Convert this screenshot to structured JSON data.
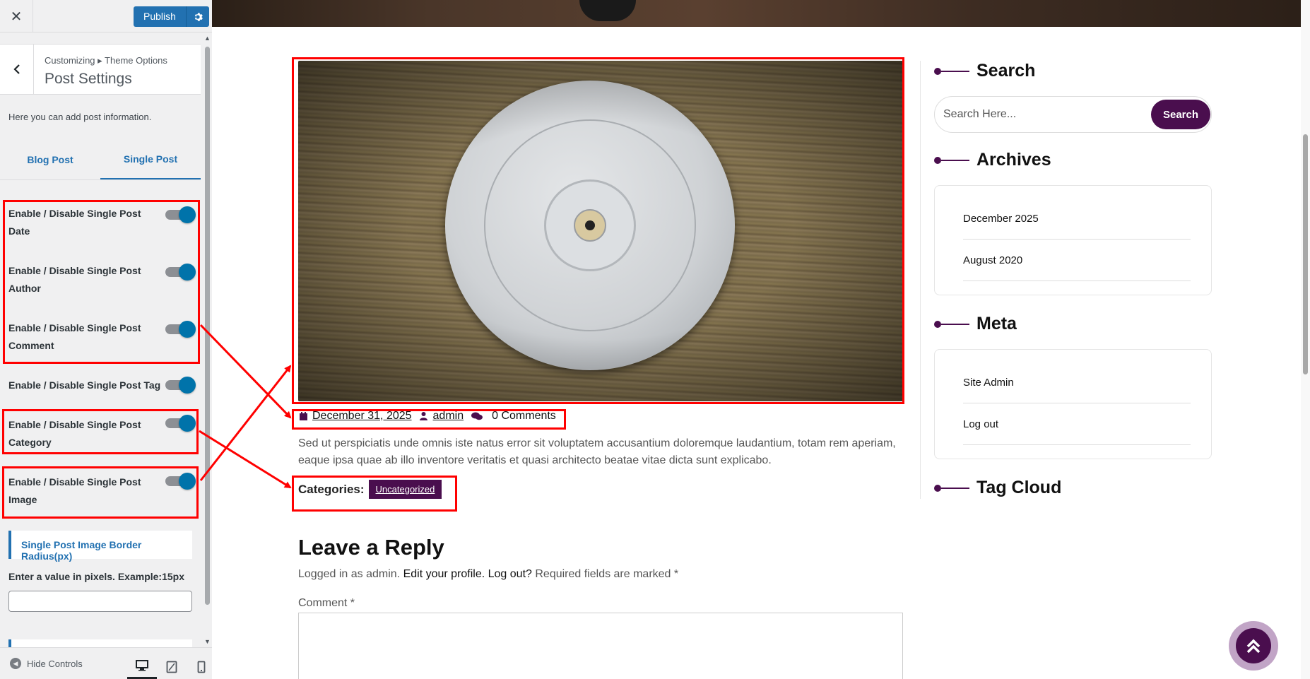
{
  "customizer": {
    "close_icon": "close-icon",
    "publish_label": "Publish",
    "breadcrumb": "Customizing ▸ Theme Options",
    "section_title": "Post Settings",
    "description": "Here you can add post information.",
    "tabs": [
      {
        "label": "Blog Post",
        "active": false
      },
      {
        "label": "Single Post",
        "active": true
      }
    ],
    "toggles": [
      {
        "label": "Enable / Disable Single Post Date",
        "on": true
      },
      {
        "label": "Enable / Disable Single Post Author",
        "on": true
      },
      {
        "label": "Enable / Disable Single Post Comment",
        "on": true
      },
      {
        "label": "Enable / Disable Single Post Tag",
        "on": true
      },
      {
        "label": "Enable / Disable Single Post Category",
        "on": true
      },
      {
        "label": "Enable / Disable Single Post Image",
        "on": true
      }
    ],
    "radius_heading": "Single Post Image Border Radius(px)",
    "pixels_label": "Enter a value in pixels. Example:15px",
    "pixels_value": "",
    "hide_controls": "Hide Controls"
  },
  "post": {
    "date": "December 31, 2025",
    "author": "admin",
    "comments": "0 Comments",
    "excerpt": "Sed ut perspiciatis unde omnis iste natus error sit voluptatem accusantium doloremque laudantium, totam rem aperiam, eaque ipsa quae ab illo inventore veritatis et quasi architecto beatae vitae dicta sunt explicabo.",
    "categories_label": "Categories:",
    "category": "Uncategorized"
  },
  "reply": {
    "title": "Leave a Reply",
    "logged_prefix": "Logged in as admin.",
    "edit_profile": "Edit your profile.",
    "log_out": "Log out?",
    "required": "Required fields are marked",
    "required_star": "*",
    "comment_label": "Comment *"
  },
  "sidebar_widgets": {
    "search": {
      "title": "Search",
      "placeholder": "Search Here...",
      "button": "Search"
    },
    "archives": {
      "title": "Archives",
      "items": [
        "December 2025",
        "August 2020"
      ]
    },
    "meta": {
      "title": "Meta",
      "items": [
        "Site Admin",
        "Log out"
      ]
    },
    "tag_cloud": {
      "title": "Tag Cloud"
    }
  },
  "colors": {
    "wp_blue": "#2271b1",
    "toggle_on": "#0073aa",
    "brand_purple": "#4a0e4e",
    "annotation_red": "#ff0000"
  }
}
